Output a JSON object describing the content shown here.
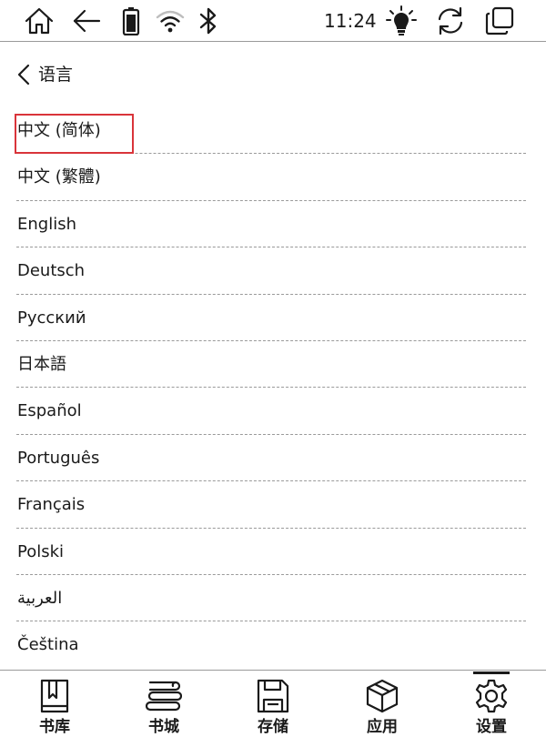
{
  "status_bar": {
    "time": "11:24",
    "icons": [
      "home-icon",
      "back-arrow-icon",
      "battery-icon",
      "wifi-icon",
      "bluetooth-icon",
      "frontlight-icon",
      "refresh-icon",
      "multitask-icon"
    ]
  },
  "header": {
    "back_icon": "chevron-left-icon",
    "title": "语言"
  },
  "languages": [
    {
      "label": "中文 (简体)",
      "selected": true
    },
    {
      "label": "中文 (繁體)",
      "selected": false
    },
    {
      "label": "English",
      "selected": false
    },
    {
      "label": "Deutsch",
      "selected": false
    },
    {
      "label": "Русский",
      "selected": false
    },
    {
      "label": "日本語",
      "selected": false
    },
    {
      "label": "Español",
      "selected": false
    },
    {
      "label": "Português",
      "selected": false
    },
    {
      "label": "Français",
      "selected": false
    },
    {
      "label": "Polski",
      "selected": false
    },
    {
      "label": "العربية",
      "selected": false
    },
    {
      "label": "Čeština",
      "selected": false
    }
  ],
  "bottom_nav": [
    {
      "label": "书库",
      "icon": "library-book-icon",
      "active": false
    },
    {
      "label": "书城",
      "icon": "bookstore-stack-icon",
      "active": false
    },
    {
      "label": "存储",
      "icon": "storage-save-icon",
      "active": false
    },
    {
      "label": "应用",
      "icon": "apps-cube-icon",
      "active": false
    },
    {
      "label": "设置",
      "icon": "settings-gear-icon",
      "active": true
    }
  ],
  "colors": {
    "selection_border": "#d9343a",
    "text": "#1a1a1a",
    "divider": "#9a9a9a"
  }
}
